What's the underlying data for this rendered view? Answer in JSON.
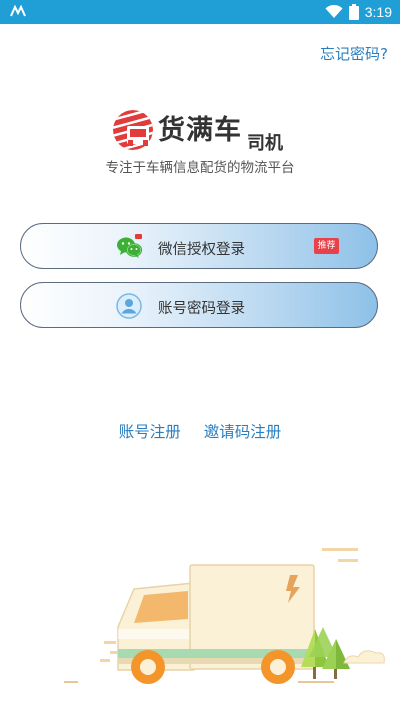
{
  "status_bar": {
    "time": "3:19",
    "icons": [
      "notification-icon",
      "wifi-icon",
      "battery-icon"
    ]
  },
  "header": {
    "forgot_password": "忘记密码?"
  },
  "logo": {
    "title": "货满车",
    "subtitle": "司机",
    "slogan": "专注于车辆信息配货的物流平台"
  },
  "login_options": {
    "wechat": {
      "label": "微信授权登录",
      "badge": "推荐",
      "icon": "wechat-icon"
    },
    "account": {
      "label": "账号密码登录",
      "icon": "user-icon"
    }
  },
  "links": {
    "register": "账号注册",
    "invite_register": "邀请码注册"
  },
  "colors": {
    "status_bar": "#1f9fd6",
    "link": "#2b7fc0",
    "logo_red": "#e23b3b",
    "badge": "#e9414a"
  }
}
